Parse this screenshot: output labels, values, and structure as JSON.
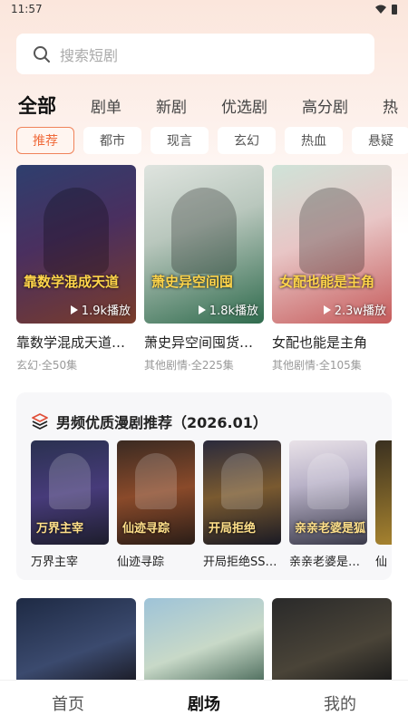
{
  "status_bar": {
    "time": "11:57"
  },
  "search": {
    "placeholder": "搜索短剧"
  },
  "main_tabs": [
    "全部",
    "剧单",
    "新剧",
    "优选剧",
    "高分剧",
    "热"
  ],
  "sub_tabs": [
    "推荐",
    "都市",
    "现言",
    "玄幻",
    "热血",
    "悬疑"
  ],
  "cards": [
    {
      "title": "靠数学混成天道…",
      "plays": "1.9k播放",
      "meta": "玄幻·全50集",
      "overlay": "靠数学混成天道"
    },
    {
      "title": "萧史异空间囤货…",
      "plays": "1.8k播放",
      "meta": "其他剧情·全225集",
      "overlay": "萧史异空间囤"
    },
    {
      "title": "女配也能是主角",
      "plays": "2.3w播放",
      "meta": "其他剧情·全105集",
      "overlay": "女配也能是主角"
    }
  ],
  "recommend": {
    "title": "男频优质漫剧推荐（2026.01）",
    "items": [
      {
        "name": "万界主宰",
        "overlay": "万界主宰"
      },
      {
        "name": "仙迹寻踪",
        "overlay": "仙迹寻踪"
      },
      {
        "name": "开局拒绝SS…",
        "overlay": "开局拒绝"
      },
      {
        "name": "亲亲老婆是…",
        "overlay": "亲亲老婆是狐"
      },
      {
        "name": "仙",
        "overlay": ""
      }
    ]
  },
  "bottom_nav": [
    "首页",
    "剧场",
    "我的"
  ],
  "colors": {
    "accent": "#f06a3a"
  }
}
